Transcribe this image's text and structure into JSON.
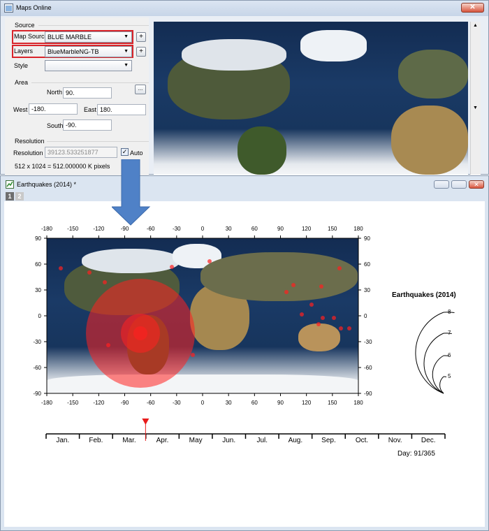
{
  "maps_window": {
    "title": "Maps Online",
    "source_section": "Source",
    "map_source_label": "Map Source",
    "map_source_value": "BLUE MARBLE",
    "layers_label": "Layers",
    "layers_value": "BlueMarbleNG-TB",
    "style_label": "Style",
    "style_value": "",
    "add_symbol": "+",
    "area_section": "Area",
    "north_label": "North",
    "north_value": "90.",
    "west_label": "West",
    "west_value": "-180.",
    "east_label": "East",
    "east_value": "180.",
    "south_label": "South",
    "south_value": "-90.",
    "ellipsis": "...",
    "resolution_section": "Resolution",
    "resolution_label": "Resolution",
    "resolution_value": "39123.533251877",
    "auto_label": "Auto",
    "auto_checked": true,
    "pixels_text": "512 x 1024 = 512.000000 K pixels"
  },
  "graph_window": {
    "title": "Earthquakes (2014) *",
    "layer_tabs": [
      "1",
      "2"
    ],
    "map_lon_ticks": [
      "-180",
      "-150",
      "-120",
      "-90",
      "-60",
      "-30",
      "0",
      "30",
      "60",
      "90",
      "120",
      "150",
      "180"
    ],
    "map_lat_ticks": [
      "90",
      "60",
      "30",
      "0",
      "-30",
      "-60",
      "-90"
    ],
    "legend_title": "Earthquakes (2014)",
    "legend_magnitudes": [
      "8",
      "7",
      "6",
      "5"
    ],
    "months": [
      "Jan.",
      "Feb.",
      "Mar.",
      "Apr.",
      "May",
      "Jun.",
      "Jul.",
      "Aug.",
      "Sep.",
      "Oct.",
      "Nov.",
      "Dec."
    ],
    "day_text": "Day: 91/365",
    "day_value": 91,
    "days_total": 365
  },
  "colors": {
    "highlight_red": "#d9242a",
    "arrow_blue": "#4f81c7",
    "quake_red": "#ff2020",
    "marker_red": "#e81b1b"
  }
}
